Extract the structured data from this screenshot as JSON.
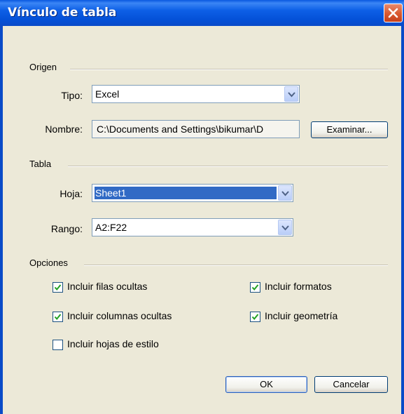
{
  "window": {
    "title": "Vínculo de tabla"
  },
  "origen": {
    "group_label": "Origen",
    "tipo_label": "Tipo:",
    "tipo_value": "Excel",
    "nombre_label": "Nombre:",
    "nombre_value": "C:\\Documents and Settings\\bikumar\\D",
    "examinar_label": "Examinar..."
  },
  "tabla": {
    "group_label": "Tabla",
    "hoja_label": "Hoja:",
    "hoja_value": "Sheet1",
    "rango_label": "Rango:",
    "rango_value": "A2:F22"
  },
  "opciones": {
    "group_label": "Opciones",
    "checkboxes": [
      {
        "label": "Incluir filas ocultas",
        "checked": true
      },
      {
        "label": "Incluir formatos",
        "checked": true
      },
      {
        "label": "Incluir columnas ocultas",
        "checked": true
      },
      {
        "label": "Incluir geometría",
        "checked": true
      },
      {
        "label": "Incluir hojas de estilo",
        "checked": false
      }
    ]
  },
  "buttons": {
    "ok_label": "OK",
    "cancel_label": "Cancelar"
  },
  "icons": {
    "close": "close-icon",
    "dropdown": "chevron-down-icon",
    "check": "checkmark-icon"
  },
  "colors": {
    "titlebar": "#0a58e0",
    "dialog_bg": "#ece9d8",
    "selection": "#316ac5",
    "close_button": "#d9582f"
  }
}
